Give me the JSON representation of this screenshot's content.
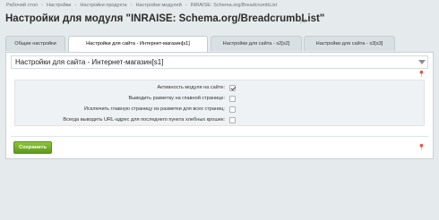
{
  "breadcrumb": {
    "items": [
      "Рабочий стол",
      "Настройки",
      "Настройки продукта",
      "Настройки модулей",
      "INRAISE: Schema.org/BreadcrumbList"
    ],
    "separator": "›"
  },
  "page": {
    "title": "Настройки для модуля \"INRAISE: Schema.org/BreadcrumbList\"",
    "star_icon": "star-outline-icon"
  },
  "tabs": [
    {
      "label": "Общие настройки",
      "active": false
    },
    {
      "label": "Настройки для сайта - Интернет-магазин[s1]",
      "active": true
    },
    {
      "label": "Настройки для сайта - s2[s2]",
      "active": false
    },
    {
      "label": "Настройки для сайта - s3[s3]",
      "active": false
    }
  ],
  "panel": {
    "title": "Настройки для сайта - Интернет-магазин[s1]",
    "options": [
      {
        "label": "Активность модуля на сайте:",
        "checked": true
      },
      {
        "label": "Выводить разметку на главной странице:",
        "checked": false
      },
      {
        "label": "Исключить главную страницу из разметки для всех страниц:",
        "checked": false
      },
      {
        "label": "Всегда выводить URL-адрес для последнего пункта хлебных крошек:",
        "checked": false
      }
    ],
    "save_label": "Сохранить"
  },
  "colors": {
    "background": "#e5eaec",
    "save_button": "#6fae24"
  }
}
